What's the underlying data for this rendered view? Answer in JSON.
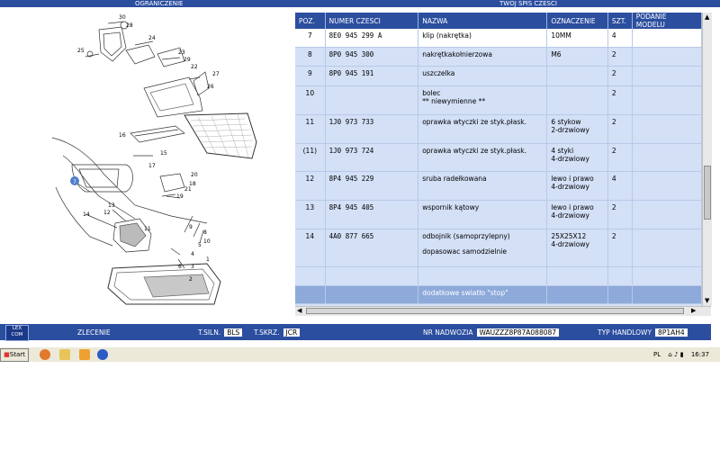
{
  "header": {
    "left_title": "OGRANICZENIE",
    "right_title": "TWOJ SPIS CZESCI"
  },
  "columns": [
    "POZ.",
    "NUMER CZESCI",
    "NAZWA",
    "OZNACZENIE",
    "SZT.",
    "PODANIE MODELU"
  ],
  "rows": [
    {
      "poz": "7",
      "numer": "8E0 945 299 A",
      "nazwa": "klip (nakrętka)",
      "nazwa2": "",
      "nazwa3": "",
      "ozn": "10MM",
      "ozn2": "",
      "szt": "4"
    },
    {
      "poz": "8",
      "numer": "8P0 945 300",
      "nazwa": "nakrętkakołnierzowa",
      "nazwa2": "",
      "nazwa3": "",
      "ozn": "M6",
      "ozn2": "",
      "szt": "2"
    },
    {
      "poz": "9",
      "numer": "8P0 945 191",
      "nazwa": "uszczelka",
      "nazwa2": "",
      "nazwa3": "",
      "ozn": "",
      "ozn2": "",
      "szt": "2"
    },
    {
      "poz": "10",
      "numer": "",
      "nazwa": "bolec",
      "nazwa2": "** niewymienne **",
      "nazwa3": "",
      "ozn": "",
      "ozn2": "",
      "szt": "2"
    },
    {
      "poz": "11",
      "numer": "1J0 973 733",
      "nazwa": "oprawka wtyczki ze styk.płask.",
      "nazwa2": "",
      "nazwa3": "",
      "ozn": "6 stykow",
      "ozn2": "2-drzwiowy",
      "szt": "2"
    },
    {
      "poz": "(11)",
      "numer": "1J0 973 724",
      "nazwa": "oprawka wtyczki ze styk.płask.",
      "nazwa2": "",
      "nazwa3": "",
      "ozn": "4 styki",
      "ozn2": "4-drzwiowy",
      "szt": "2"
    },
    {
      "poz": "12",
      "numer": "8P4 945 229",
      "nazwa": "sruba radełkowana",
      "nazwa2": "",
      "nazwa3": "",
      "ozn": "lewo i prawo",
      "ozn2": "4-drzwiowy",
      "szt": "4"
    },
    {
      "poz": "13",
      "numer": "8P4 945 405",
      "nazwa": "wspornik kątowy",
      "nazwa2": "",
      "nazwa3": "",
      "ozn": "lewo i prawo",
      "ozn2": "4-drzwiowy",
      "szt": "2"
    },
    {
      "poz": "14",
      "numer": "4A0 877 665",
      "nazwa": "odbojnik (samoprzylepny)",
      "nazwa2": "",
      "nazwa3": "dopasowac samodzielnie",
      "ozn": "25X25X12",
      "ozn2": "4-drzwiowy",
      "szt": "2"
    },
    {
      "poz": "",
      "numer": "",
      "nazwa": "",
      "nazwa2": "",
      "nazwa3": "",
      "ozn": "",
      "ozn2": "",
      "szt": ""
    },
    {
      "poz": "",
      "numer": "",
      "nazwa": "dodatkowe swiatło \"stop\"",
      "nazwa2": "",
      "nazwa3": "",
      "ozn": "",
      "ozn2": "",
      "szt": ""
    }
  ],
  "status": {
    "logo": "LEX COM",
    "zlecenie_label": "ZLECENIE",
    "tsiln_label": "T.SILN.",
    "tsiln_value": "BLS",
    "tskrz_label": "T.SKRZ.",
    "tskrz_value": "JCR",
    "nadwozia_label": "NR NADWOZIA",
    "nadwozia_value": "WAUZZZ8P87A088087",
    "typ_label": "TYP HANDLOWY",
    "typ_value": "8P1AH4"
  },
  "taskbar": {
    "start": "Start",
    "lang": "PL",
    "time": "16:37"
  },
  "diagram_labels": [
    "30",
    "28",
    "25",
    "24",
    "27",
    "23",
    "22",
    "1",
    "2",
    "5",
    "7",
    "18",
    "17",
    "16",
    "15",
    "14",
    "13",
    "12",
    "11",
    "10",
    "9",
    "8",
    "6",
    "4",
    "3",
    "19",
    "20",
    "21",
    "29",
    "26"
  ]
}
